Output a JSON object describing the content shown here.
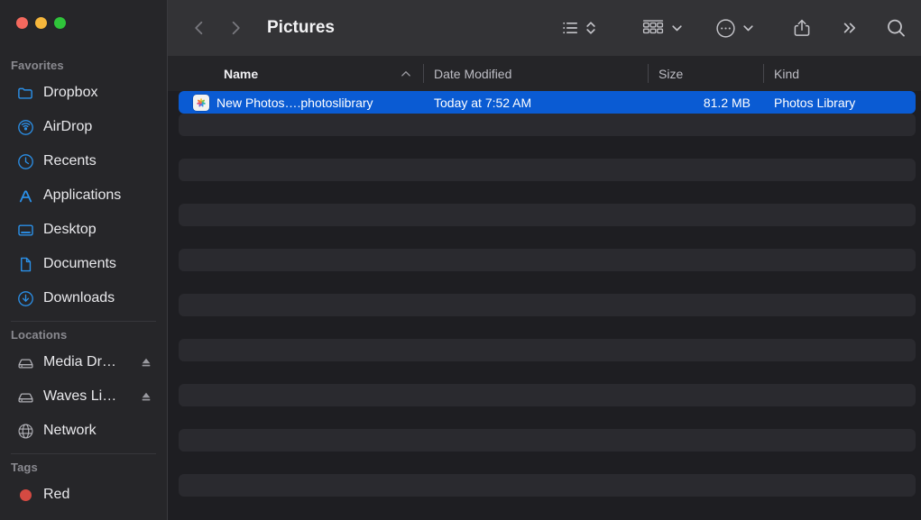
{
  "window": {
    "traffic_lights": [
      {
        "name": "close",
        "color": "#f4695e"
      },
      {
        "name": "minimize",
        "color": "#f6b73c"
      },
      {
        "name": "maximize",
        "color": "#2fc43a"
      }
    ]
  },
  "toolbar": {
    "back_label": "Back",
    "forward_label": "Forward",
    "title": "Pictures",
    "icons": {
      "list_view": "list-view-icon",
      "view_stepper": "up-down-chevron-icon",
      "group_by": "group-by-icon",
      "group_by_chevron": "chevron-down-icon",
      "action_menu": "ellipsis-circle-icon",
      "action_menu_chevron": "chevron-down-icon",
      "share": "share-icon",
      "more": "double-chevron-right-icon",
      "search": "search-icon"
    }
  },
  "sidebar": {
    "sections": [
      {
        "title": "Favorites",
        "items": [
          {
            "label": "Dropbox",
            "icon": "folder-icon",
            "eject": false
          },
          {
            "label": "AirDrop",
            "icon": "airdrop-icon",
            "eject": false
          },
          {
            "label": "Recents",
            "icon": "clock-icon",
            "eject": false
          },
          {
            "label": "Applications",
            "icon": "applications-icon",
            "eject": false
          },
          {
            "label": "Desktop",
            "icon": "desktop-icon",
            "eject": false
          },
          {
            "label": "Documents",
            "icon": "document-icon",
            "eject": false
          },
          {
            "label": "Downloads",
            "icon": "download-icon",
            "eject": false
          }
        ]
      },
      {
        "title": "Locations",
        "items": [
          {
            "label": "Media Dr…",
            "icon": "external-drive-icon",
            "eject": true
          },
          {
            "label": "Waves Li…",
            "icon": "external-drive-icon",
            "eject": true
          },
          {
            "label": "Network",
            "icon": "globe-icon",
            "eject": false
          }
        ]
      },
      {
        "title": "Tags",
        "items": [
          {
            "label": "Red",
            "icon": "tag-dot-icon",
            "color": "#d44a42",
            "eject": false
          }
        ]
      }
    ]
  },
  "file_list": {
    "columns": [
      {
        "key": "name",
        "label": "Name",
        "sorted": true,
        "sort_direction": "ascending"
      },
      {
        "key": "date",
        "label": "Date Modified",
        "sorted": false
      },
      {
        "key": "size",
        "label": "Size",
        "sorted": false
      },
      {
        "key": "kind",
        "label": "Kind",
        "sorted": false
      }
    ],
    "rows": [
      {
        "name": "New Photos….photoslibrary",
        "date": "Today at 7:52 AM",
        "size": "81.2 MB",
        "kind": "Photos Library",
        "icon": "photos-library-icon",
        "selected": true
      }
    ],
    "empty_row_count": 17,
    "selection_color": "#0a5bd3"
  }
}
